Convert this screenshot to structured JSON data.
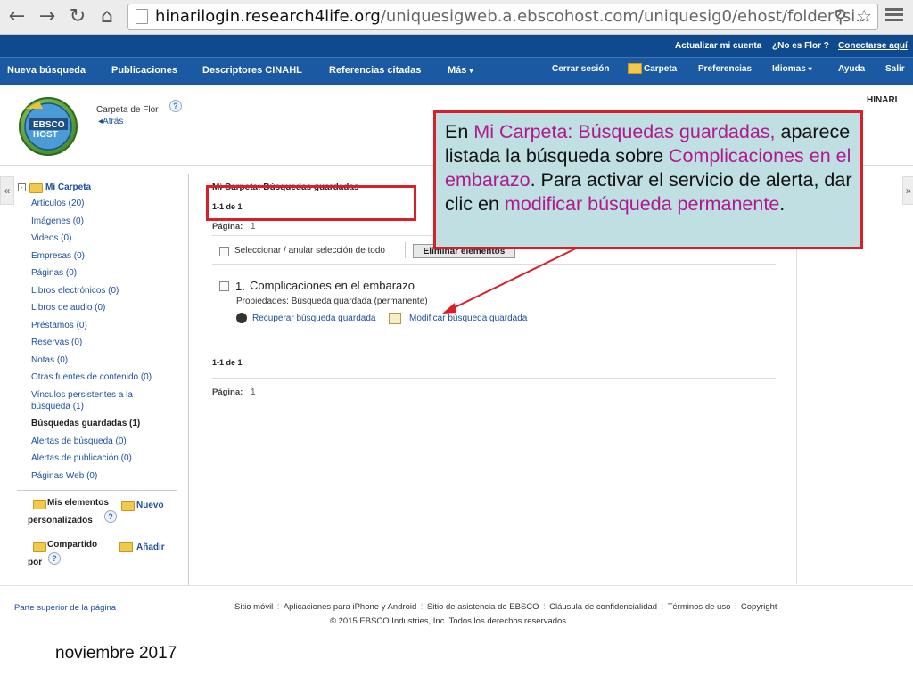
{
  "browser": {
    "url_host": "hinarilogin.research4life.org",
    "url_path": "/uniquesigweb.a.ebscohost.com/uniquesig0/ehost/folder?si..."
  },
  "topbar": {
    "account": "Actualizar mi cuenta",
    "not_user": "¿No es Flor ?",
    "connect": "Conectarse aquí",
    "menu": [
      "Nueva búsqueda",
      "Publicaciones",
      "Descriptores CINAHL",
      "Referencias citadas",
      "Más"
    ],
    "right": [
      "Cerrar sesión",
      "Carpeta",
      "Preferencias",
      "Idiomas",
      "Ayuda",
      "Salir"
    ]
  },
  "header": {
    "logo_text": "EBSCO HOST",
    "folder_owner": "Carpeta de Flor",
    "back": "◂Atrás",
    "hinari": "HINARI"
  },
  "sidebar": {
    "root": "Mi Carpeta",
    "items": [
      "Artículos (20)",
      "Imágenes (0)",
      "Videos (0)",
      "Empresas (0)",
      "Páginas (0)",
      "Libros electrónicos (0)",
      "Libros de audio (0)",
      "Préstamos (0)",
      "Reservas (0)",
      "Notas (0)",
      "Otras fuentes de contenido (0)",
      "Vínculos persistentes a la",
      "búsqueda (1)",
      "Búsquedas guardadas (1)",
      "Alertas de búsqueda (0)",
      "Alertas de publicación (0)",
      "Páginas Web (0)"
    ],
    "mis_elementos": "Mis elementos",
    "personalizados": "personalizados",
    "nuevo": "Nuevo",
    "compartido": "Compartido",
    "por": "por",
    "anadir": "Añadir",
    "collapse_left": "«",
    "collapse_right": "»"
  },
  "main": {
    "title": "Mi Carpeta: Búsquedas guardadas",
    "range": "1-1 de 1",
    "page_label": "Página:",
    "page_num": "1",
    "select_all": "Seleccionar / anular selección de todo",
    "delete_btn": "Eliminar elementos",
    "result_num": "1.",
    "result_title": "Complicaciones en el embarazo",
    "properties": "Propiedades: Búsqueda guardada (permanente)",
    "retrieve": "Recuperar búsqueda guardada",
    "modify": "Modificar búsqueda guardada",
    "range_bottom": "1-1 de 1",
    "page_label_bottom": "Página:",
    "page_num_bottom": "1"
  },
  "callout": {
    "t1": "En ",
    "t2": "Mi Carpeta: Búsquedas guardadas,",
    "t3": " aparece listada la búsqueda sobre ",
    "t4": "Complicaciones en el embarazo",
    "t5": ".  Para activar el servicio de alerta, dar clic en ",
    "t6": "modificar búsqueda permanente",
    "t7": "."
  },
  "footer": {
    "top_link": "Parte superior de la página",
    "links": [
      "Sitio móvil",
      "Aplicaciones para iPhone y Android",
      "Sitio de asistencia de EBSCO",
      "Cláusula de confidencialidad",
      "Términos de uso",
      "Copyright"
    ],
    "copyright": "© 2015 EBSCO Industries, Inc. Todos los derechos reservados."
  },
  "slide_date": "noviembre 2017",
  "colors": {
    "nav_dark": "#104a8e",
    "nav": "#1b5aa3",
    "callout_bg": "#bfdfe2",
    "callout_border": "#d9202a",
    "highlight": "#b0198e"
  }
}
